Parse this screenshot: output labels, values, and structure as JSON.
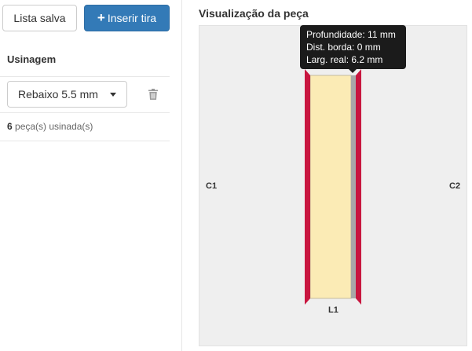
{
  "toolbar": {
    "saved_list_label": "Lista salva",
    "insert_strip_icon": "plus-icon",
    "insert_strip_label": "Inserir tira"
  },
  "machining": {
    "section_title": "Usinagem",
    "selected_option": "Rebaixo 5.5 mm",
    "delete_icon": "trash-icon",
    "count": "6",
    "count_suffix": "peça(s) usinada(s)"
  },
  "preview": {
    "title": "Visualização da peça",
    "labels": {
      "c1": "C1",
      "c2": "C2",
      "l1": "L1"
    },
    "tooltip": {
      "depth": "Profundidade: 11 mm",
      "edge_distance": "Dist. borda: 0 mm",
      "real_width": "Larg. real: 6.2 mm"
    },
    "colors": {
      "piece_fill": "#fbebb5",
      "edge_band": "#c8163f",
      "groove": "#a8a8a8",
      "primary_button": "#337ab7"
    }
  }
}
